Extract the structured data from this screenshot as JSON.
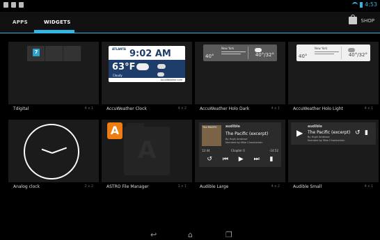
{
  "status": {
    "time": "4:53"
  },
  "tabs": {
    "apps": "APPS",
    "widgets": "WIDGETS",
    "shop": "SHOP"
  },
  "widgets": [
    {
      "name": "Tdigital",
      "size": "4 x 1"
    },
    {
      "name": "AccuWeather Clock",
      "size": "4 x 2"
    },
    {
      "name": "AccuWeather Holo Dark",
      "size": "4 x 1"
    },
    {
      "name": "AccuWeather Holo Light",
      "size": "4 x 1"
    },
    {
      "name": "Analog clock",
      "size": "2 x 2"
    },
    {
      "name": "ASTRO File Manager",
      "size": "1 x 1"
    },
    {
      "name": "Audible Large",
      "size": "4 x 2"
    },
    {
      "name": "Audible Small",
      "size": "4 x 1"
    }
  ],
  "accu_clock": {
    "city": "ATLANTA",
    "time": "9:02 AM",
    "temp": "63°F",
    "cond": "Cloudy",
    "brand": "AccuWeather.com"
  },
  "holo": {
    "city": "New York",
    "t_left": "40°",
    "t_right": "40°/32°"
  },
  "tdigital": {
    "icon": "7"
  },
  "astro": {
    "letter": "A"
  },
  "audible": {
    "logo": "audible",
    "cover_text": "The PACIFIC",
    "title": "The Pacific (excerpt)",
    "author": "By Hugh Ambrose",
    "narrator": "Narrated by Mike Chamberlain",
    "elapsed": "12:44",
    "chapter": "Chapter 0",
    "remaining": "-14:52"
  }
}
